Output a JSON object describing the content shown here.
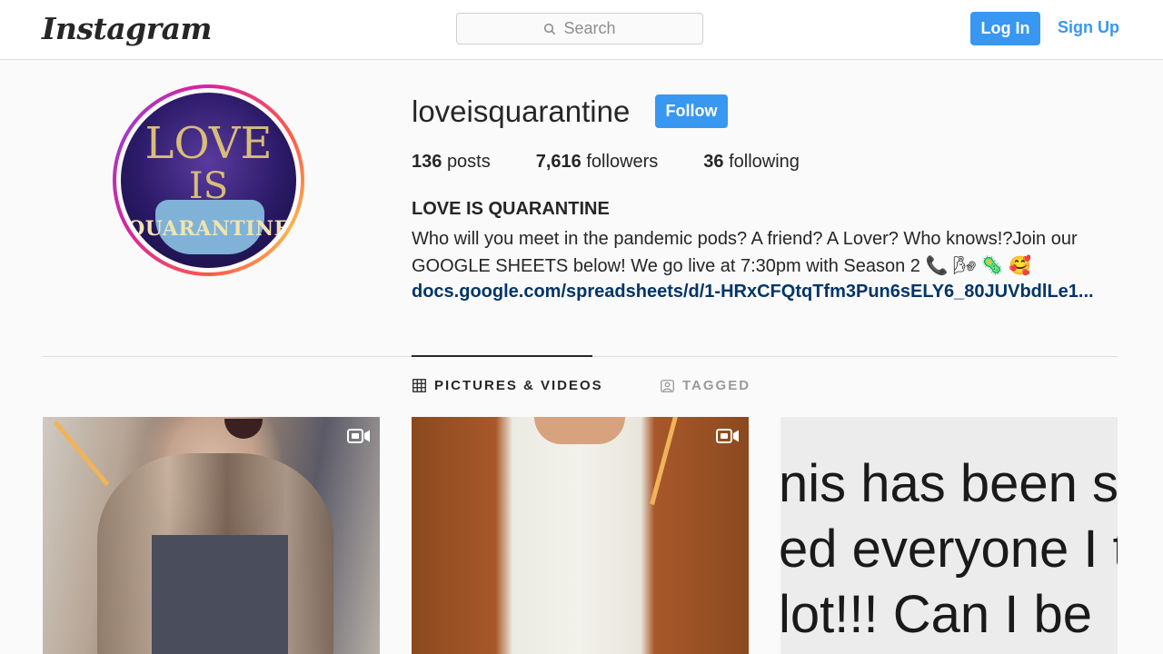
{
  "nav": {
    "logo": "Instagram",
    "search_placeholder": "Search",
    "login_label": "Log In",
    "signup_label": "Sign Up"
  },
  "profile": {
    "avatar_text_1": "LOVE",
    "avatar_text_2": "IS",
    "avatar_text_3": "QUARANTINE",
    "username": "loveisquarantine",
    "follow_label": "Follow",
    "stats": {
      "posts_count": "136",
      "posts_label": "posts",
      "followers_count": "7,616",
      "followers_label": "followers",
      "following_count": "36",
      "following_label": "following"
    },
    "full_name": "LOVE IS QUARANTINE",
    "bio": "Who will you meet in the pandemic pods? A friend? A Lover? Who knows!?Join our GOOGLE SHEETS below! We go live at 7:30pm with Season 2 📞 🌬 🦠 🥰",
    "link": "docs.google.com/spreadsheets/d/1-HRxCFQtqTfm3Pun6sELY6_80JUVbdlLe1..."
  },
  "tabs": [
    {
      "label": "PICTURES & VIDEOS",
      "active": true
    },
    {
      "label": "TAGGED",
      "active": false
    }
  ],
  "posts": [
    {
      "type": "video",
      "icon": "video-icon"
    },
    {
      "type": "video",
      "icon": "video-icon"
    },
    {
      "type": "image",
      "text_lines": [
        "nis has been s",
        "ed everyone I t",
        "lot!!! Can I be"
      ]
    }
  ],
  "colors": {
    "accent": "#3897f0",
    "link": "#003569",
    "background": "#fafafa"
  }
}
